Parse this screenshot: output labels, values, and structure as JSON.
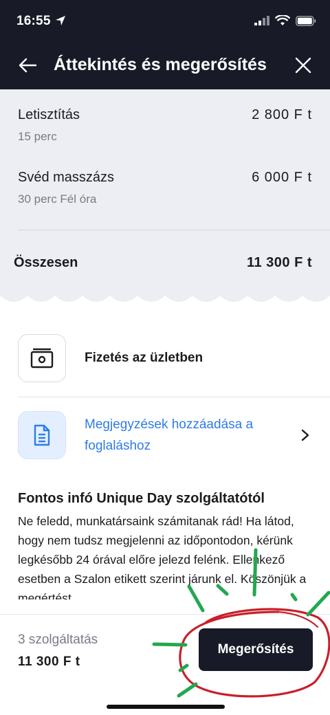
{
  "status_bar": {
    "time": "16:55"
  },
  "header": {
    "title": "Áttekintés és megerősítés"
  },
  "services": [
    {
      "name": "Letisztítás",
      "duration": "15 perc",
      "price": "2 800 F t"
    },
    {
      "name": "Svéd masszázs",
      "duration": "30 perc Fél óra",
      "price": "6 000 F t"
    }
  ],
  "summary": {
    "total_label": "Összesen",
    "total_value": "11 300 F t"
  },
  "payment": {
    "label": "Fizetés az üzletben"
  },
  "notes": {
    "label": "Megjegyzések hozzáadása a foglaláshoz"
  },
  "info": {
    "title": "Fontos infó Unique Day szolgáltatótól",
    "body": "Ne feledd, munkatársaink számitanak rád! Ha látod, hogy nem tudsz megjelenni az időpontodon, kérünk legkésőbb 24 órával előre jelezd felénk. Ellenkező esetben a Szalon etikett szerint járunk el. Köszönjük a megértést"
  },
  "footer": {
    "service_count": "3 szolgáltatás",
    "total": "11 300 F t",
    "confirm_label": "Megerősítés"
  },
  "colors": {
    "header_bg": "#181b27",
    "summary_bg": "#eceef3",
    "link_blue": "#2f7be8",
    "annotation_red": "#c8202a",
    "annotation_green": "#22a84f"
  }
}
